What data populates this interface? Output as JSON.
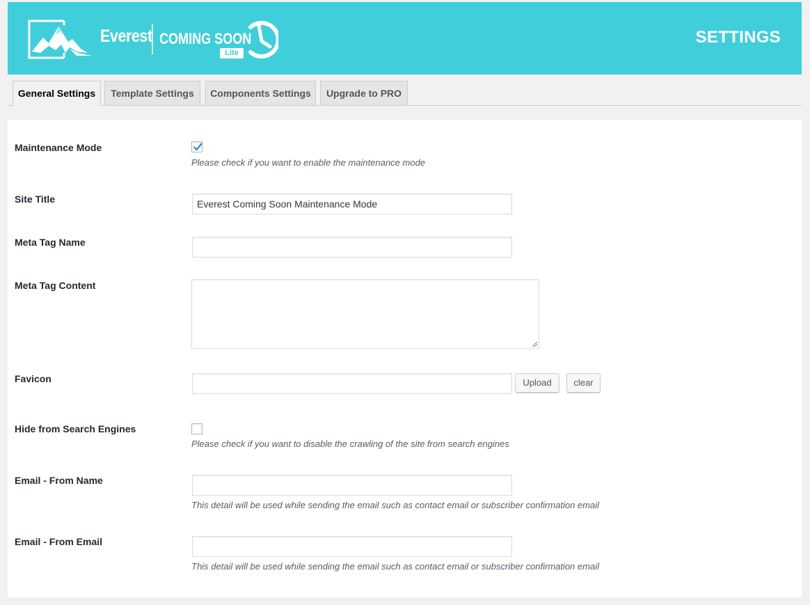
{
  "header": {
    "logo_brand": "Everest",
    "logo_product": "COMING SOON",
    "logo_badge": "Lite",
    "title": "SETTINGS",
    "background_color": "#40cedb"
  },
  "tabs": [
    {
      "label": "General Settings",
      "active": true
    },
    {
      "label": "Template Settings",
      "active": false
    },
    {
      "label": "Components Settings",
      "active": false
    },
    {
      "label": "Upgrade to PRO",
      "active": false
    }
  ],
  "form": {
    "maintenance_mode": {
      "label": "Maintenance Mode",
      "checked": true,
      "description": "Please check if you want to enable the maintenance mode"
    },
    "site_title": {
      "label": "Site Title",
      "value": "Everest Coming Soon Maintenance Mode"
    },
    "meta_tag_name": {
      "label": "Meta Tag Name",
      "value": ""
    },
    "meta_tag_content": {
      "label": "Meta Tag Content",
      "value": ""
    },
    "favicon": {
      "label": "Favicon",
      "value": "",
      "upload_label": "Upload",
      "clear_label": "clear"
    },
    "hide_search": {
      "label": "Hide from Search Engines",
      "checked": false,
      "description": "Please check if you want to disable the crawling of the site from search engines"
    },
    "email_from_name": {
      "label": "Email - From Name",
      "value": "",
      "description": "This detail will be used while sending the email such as contact email or subscriber confirmation email"
    },
    "email_from_email": {
      "label": "Email - From Email",
      "value": "",
      "description": "This detail will be used while sending the email such as contact email or subscriber confirmation email"
    }
  },
  "icons": {
    "logo_mountain": "mountain-frame-icon",
    "logo_clock": "clock-icon",
    "checkmark": "checkmark-icon",
    "resize_grip": "resize-grip-icon"
  }
}
